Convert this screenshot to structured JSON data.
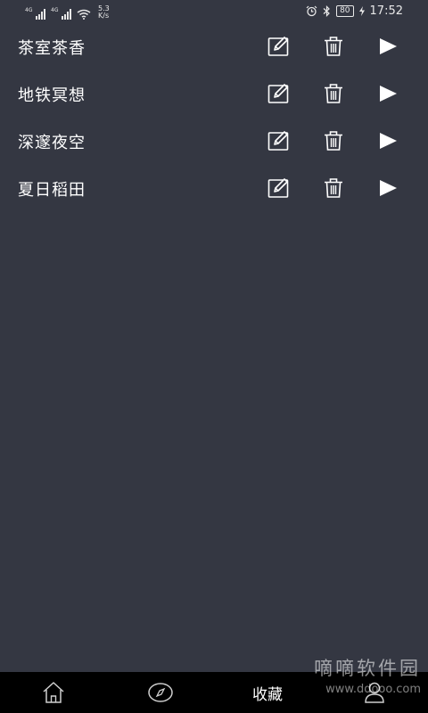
{
  "status_bar": {
    "signal1_label": "4G",
    "signal2_label": "4G",
    "speed_value": "5.3",
    "speed_unit": "K/s",
    "battery": "80",
    "time": "17:52"
  },
  "list": {
    "items": [
      {
        "name": "茶室茶香"
      },
      {
        "name": "地铁冥想"
      },
      {
        "name": "深邃夜空"
      },
      {
        "name": "夏日稻田"
      }
    ]
  },
  "bottom_nav": {
    "active_label": "收藏",
    "icons": [
      "home-icon",
      "compass-icon",
      "user-icon"
    ]
  },
  "watermark": {
    "title": "嘀嘀软件园",
    "site": "www.ddooo.com"
  }
}
